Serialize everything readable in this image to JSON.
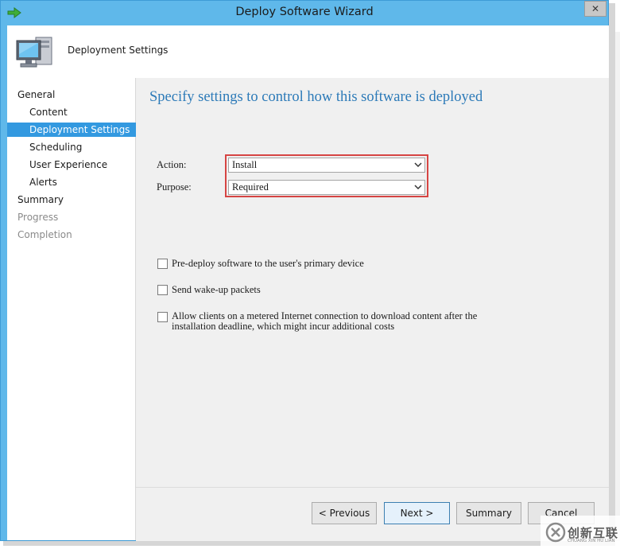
{
  "window": {
    "title": "Deploy Software Wizard",
    "close_glyph": "✕"
  },
  "header": {
    "title": "Deployment Settings",
    "icon": "computer-icon"
  },
  "nav": {
    "items": [
      {
        "label": "General",
        "state": "normal"
      },
      {
        "label": "Content",
        "state": "normal"
      },
      {
        "label": "Deployment Settings",
        "state": "selected"
      },
      {
        "label": "Scheduling",
        "state": "normal"
      },
      {
        "label": "User Experience",
        "state": "normal"
      },
      {
        "label": "Alerts",
        "state": "normal"
      },
      {
        "label": "Summary",
        "state": "normal"
      },
      {
        "label": "Progress",
        "state": "disabled"
      },
      {
        "label": "Completion",
        "state": "disabled"
      }
    ]
  },
  "main": {
    "heading": "Specify settings to control how this software is deployed",
    "action": {
      "label": "Action:",
      "value": "Install"
    },
    "purpose": {
      "label": "Purpose:",
      "value": "Required"
    },
    "checkboxes": [
      {
        "label": "Pre-deploy software to the user's primary device",
        "checked": false
      },
      {
        "label": "Send wake-up packets",
        "checked": false
      },
      {
        "label_line1": "Allow clients on a metered Internet connection to download content after the",
        "label_line2": "installation deadline, which might incur additional costs",
        "checked": false
      }
    ]
  },
  "footer": {
    "previous": "< Previous",
    "next": "Next >",
    "summary": "Summary",
    "cancel": "Cancel"
  },
  "watermark": {
    "text": "创新互联",
    "sub": "CHUANG XIN HU LIAN"
  },
  "colors": {
    "selection": "#3399e0",
    "heading": "#2c7ab8",
    "highlight": "#d64543",
    "titlebar": "#5fb8ea"
  }
}
